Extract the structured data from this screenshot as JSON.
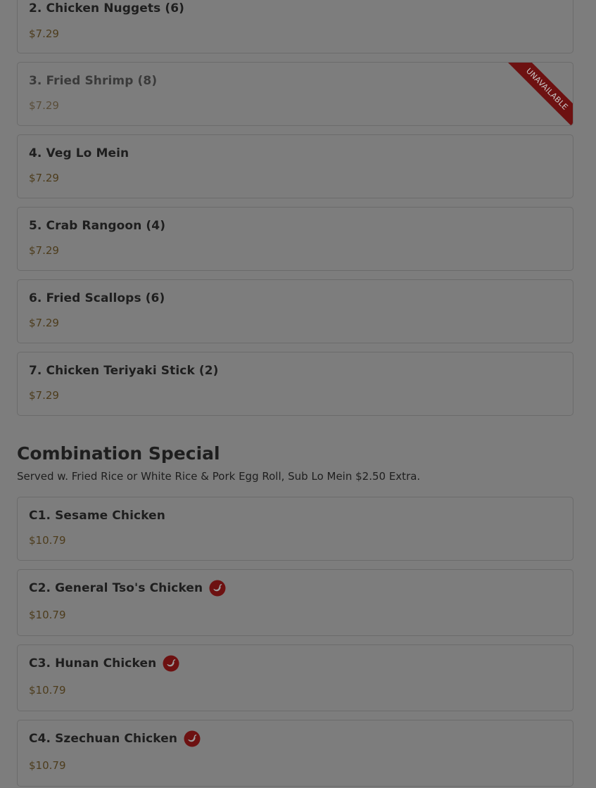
{
  "menu": {
    "items_top": [
      {
        "name": "2. Chicken Nuggets (6)",
        "price": "$7.29"
      },
      {
        "name": "3. Fried Shrimp (8)",
        "price": "$7.29",
        "badge": "UNAVAILABLE"
      },
      {
        "name": "4. Veg Lo Mein",
        "price": "$7.29"
      },
      {
        "name": "5. Crab Rangoon (4)",
        "price": "$7.29"
      },
      {
        "name": "6. Fried Scallops (6)",
        "price": "$7.29"
      },
      {
        "name": "7. Chicken Teriyaki Stick (2)",
        "price": "$7.29"
      }
    ],
    "section": {
      "title": "Combination Special",
      "description": "Served w. Fried Rice or White Rice & Pork Egg Roll, Sub Lo Mein $2.50 Extra."
    },
    "items_combo": [
      {
        "name": "C1. Sesame Chicken",
        "price": "$10.79",
        "spicy": false
      },
      {
        "name": "C2. General Tso's Chicken",
        "price": "$10.79",
        "spicy": true
      },
      {
        "name": "C3. Hunan Chicken",
        "price": "$10.79",
        "spicy": true
      },
      {
        "name": "C4. Szechuan Chicken",
        "price": "$10.79",
        "spicy": true
      }
    ]
  },
  "colors": {
    "overlay_background": "#7d7d7d",
    "accent_red": "#6d1111",
    "price": "#4d3c1c"
  },
  "icons": {
    "spicy": "chili-pepper-icon"
  }
}
